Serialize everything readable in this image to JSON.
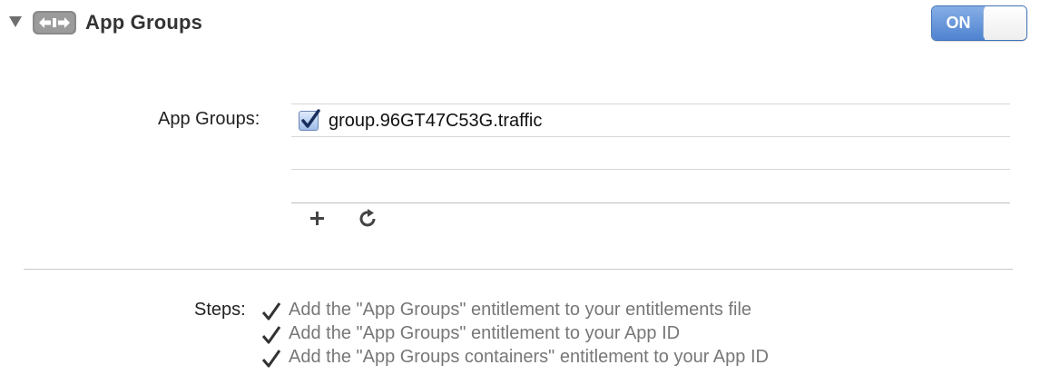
{
  "section": {
    "title": "App Groups",
    "icon": "capability-arrows-icon",
    "expanded": true
  },
  "toggle": {
    "label": "ON",
    "state": true,
    "accent": "#4f83d0"
  },
  "groups": {
    "label": "App Groups:",
    "items": [
      {
        "name": "group.96GT47C53G.traffic",
        "checked": true
      }
    ]
  },
  "toolbar": {
    "add_icon": "plus-icon",
    "refresh_icon": "refresh-icon"
  },
  "steps": {
    "label": "Steps:",
    "items": [
      "Add the \"App Groups\" entitlement to your entitlements file",
      "Add the \"App Groups\" entitlement to your App ID",
      "Add the \"App Groups containers\" entitlement to your App ID"
    ]
  }
}
